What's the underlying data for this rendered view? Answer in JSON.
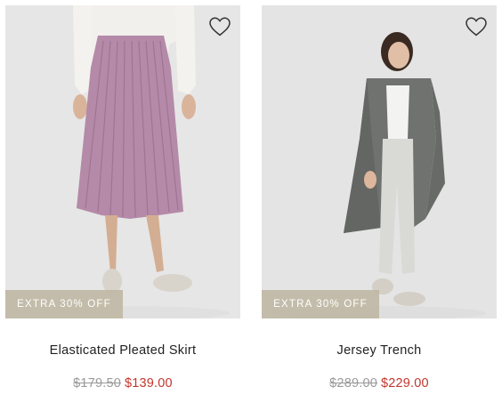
{
  "theme": {
    "sale_color": "#c2362c",
    "old_price_color": "#9a9a9a",
    "badge_color": "#beb6a2"
  },
  "products": [
    {
      "name": "Elasticated Pleated Skirt",
      "badge": "EXTRA 30% OFF",
      "original_price": "$179.50",
      "sale_price": "$139.00",
      "wishlist_icon": "heart-outline-icon"
    },
    {
      "name": "Jersey Trench",
      "badge": "EXTRA 30% OFF",
      "original_price": "$289.00",
      "sale_price": "$229.00",
      "wishlist_icon": "heart-outline-icon"
    }
  ]
}
